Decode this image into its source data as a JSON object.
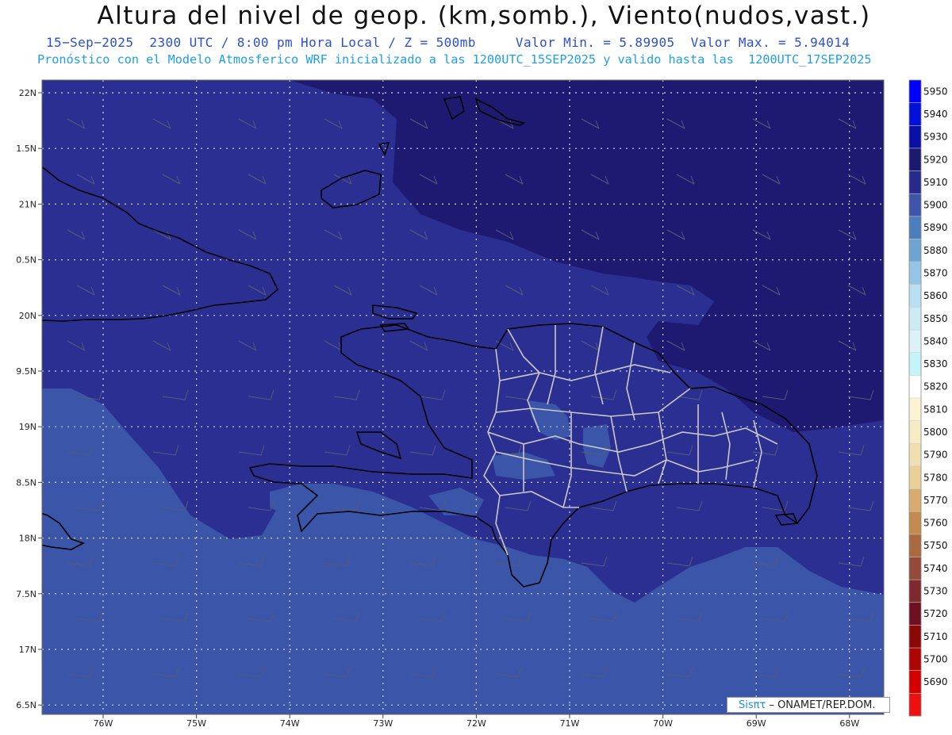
{
  "header": {
    "title": "Altura del nivel de geop. (km,somb.), Viento(nudos,vast.)",
    "subtitle": "15−Sep−2025  2300 UTC / 8:00 pm Hora Local / Z = 500mb     Valor Min. = 5.89905  Valor Max. = 5.94014",
    "subtitle2": "Pronóstico con el Modelo Atmosferico WRF inicializado a las 1200UTC_15SEP2025 y valido hasta las  1200UTC_17SEP2025"
  },
  "map": {
    "lat_labels": [
      "22N",
      "1.5N",
      "21N",
      "0.5N",
      "20N",
      "9.5N",
      "19N",
      "8.5N",
      "18N",
      "7.5N",
      "17N",
      "6.5N"
    ],
    "lon_labels": [
      "76W",
      "75W",
      "74W",
      "73W",
      "72W",
      "71W",
      "70W",
      "69W",
      "68W"
    ],
    "shading_colors": {
      "5890_5900": "#3b56a8",
      "5900_5910": "#2b2f92",
      "5910_5920": "#1e1a72",
      "coast": "#000000",
      "provinces": "#c8c8c8"
    }
  },
  "colorbar": {
    "levels": [
      "5950",
      "5940",
      "5930",
      "5920",
      "5910",
      "5900",
      "5890",
      "5880",
      "5870",
      "5860",
      "5850",
      "5840",
      "5830",
      "5820",
      "5810",
      "5800",
      "5790",
      "5780",
      "5770",
      "5760",
      "5750",
      "5740",
      "5730",
      "5720",
      "5710",
      "5700",
      "5690"
    ],
    "colors": [
      "#0000ff",
      "#0010d8",
      "#0a0fa8",
      "#1a1a6e",
      "#262a8c",
      "#3c55a8",
      "#4d7ebc",
      "#6ea3d2",
      "#96c4e4",
      "#b8e0f0",
      "#cdebf4",
      "#dcf2f8",
      "#c4f4fa",
      "#ffffff",
      "#fbf3d2",
      "#f7ecc6",
      "#f0e0b0",
      "#e8d098",
      "#d8ac70",
      "#c48a50",
      "#aa6a40",
      "#944a38",
      "#7e2830",
      "#6e1020",
      "#8a0808",
      "#b00404",
      "#d40000",
      "#ee1010"
    ]
  },
  "credit": {
    "brand": "Sisπτ",
    "text": "– ONAMET/REP.DOM."
  }
}
